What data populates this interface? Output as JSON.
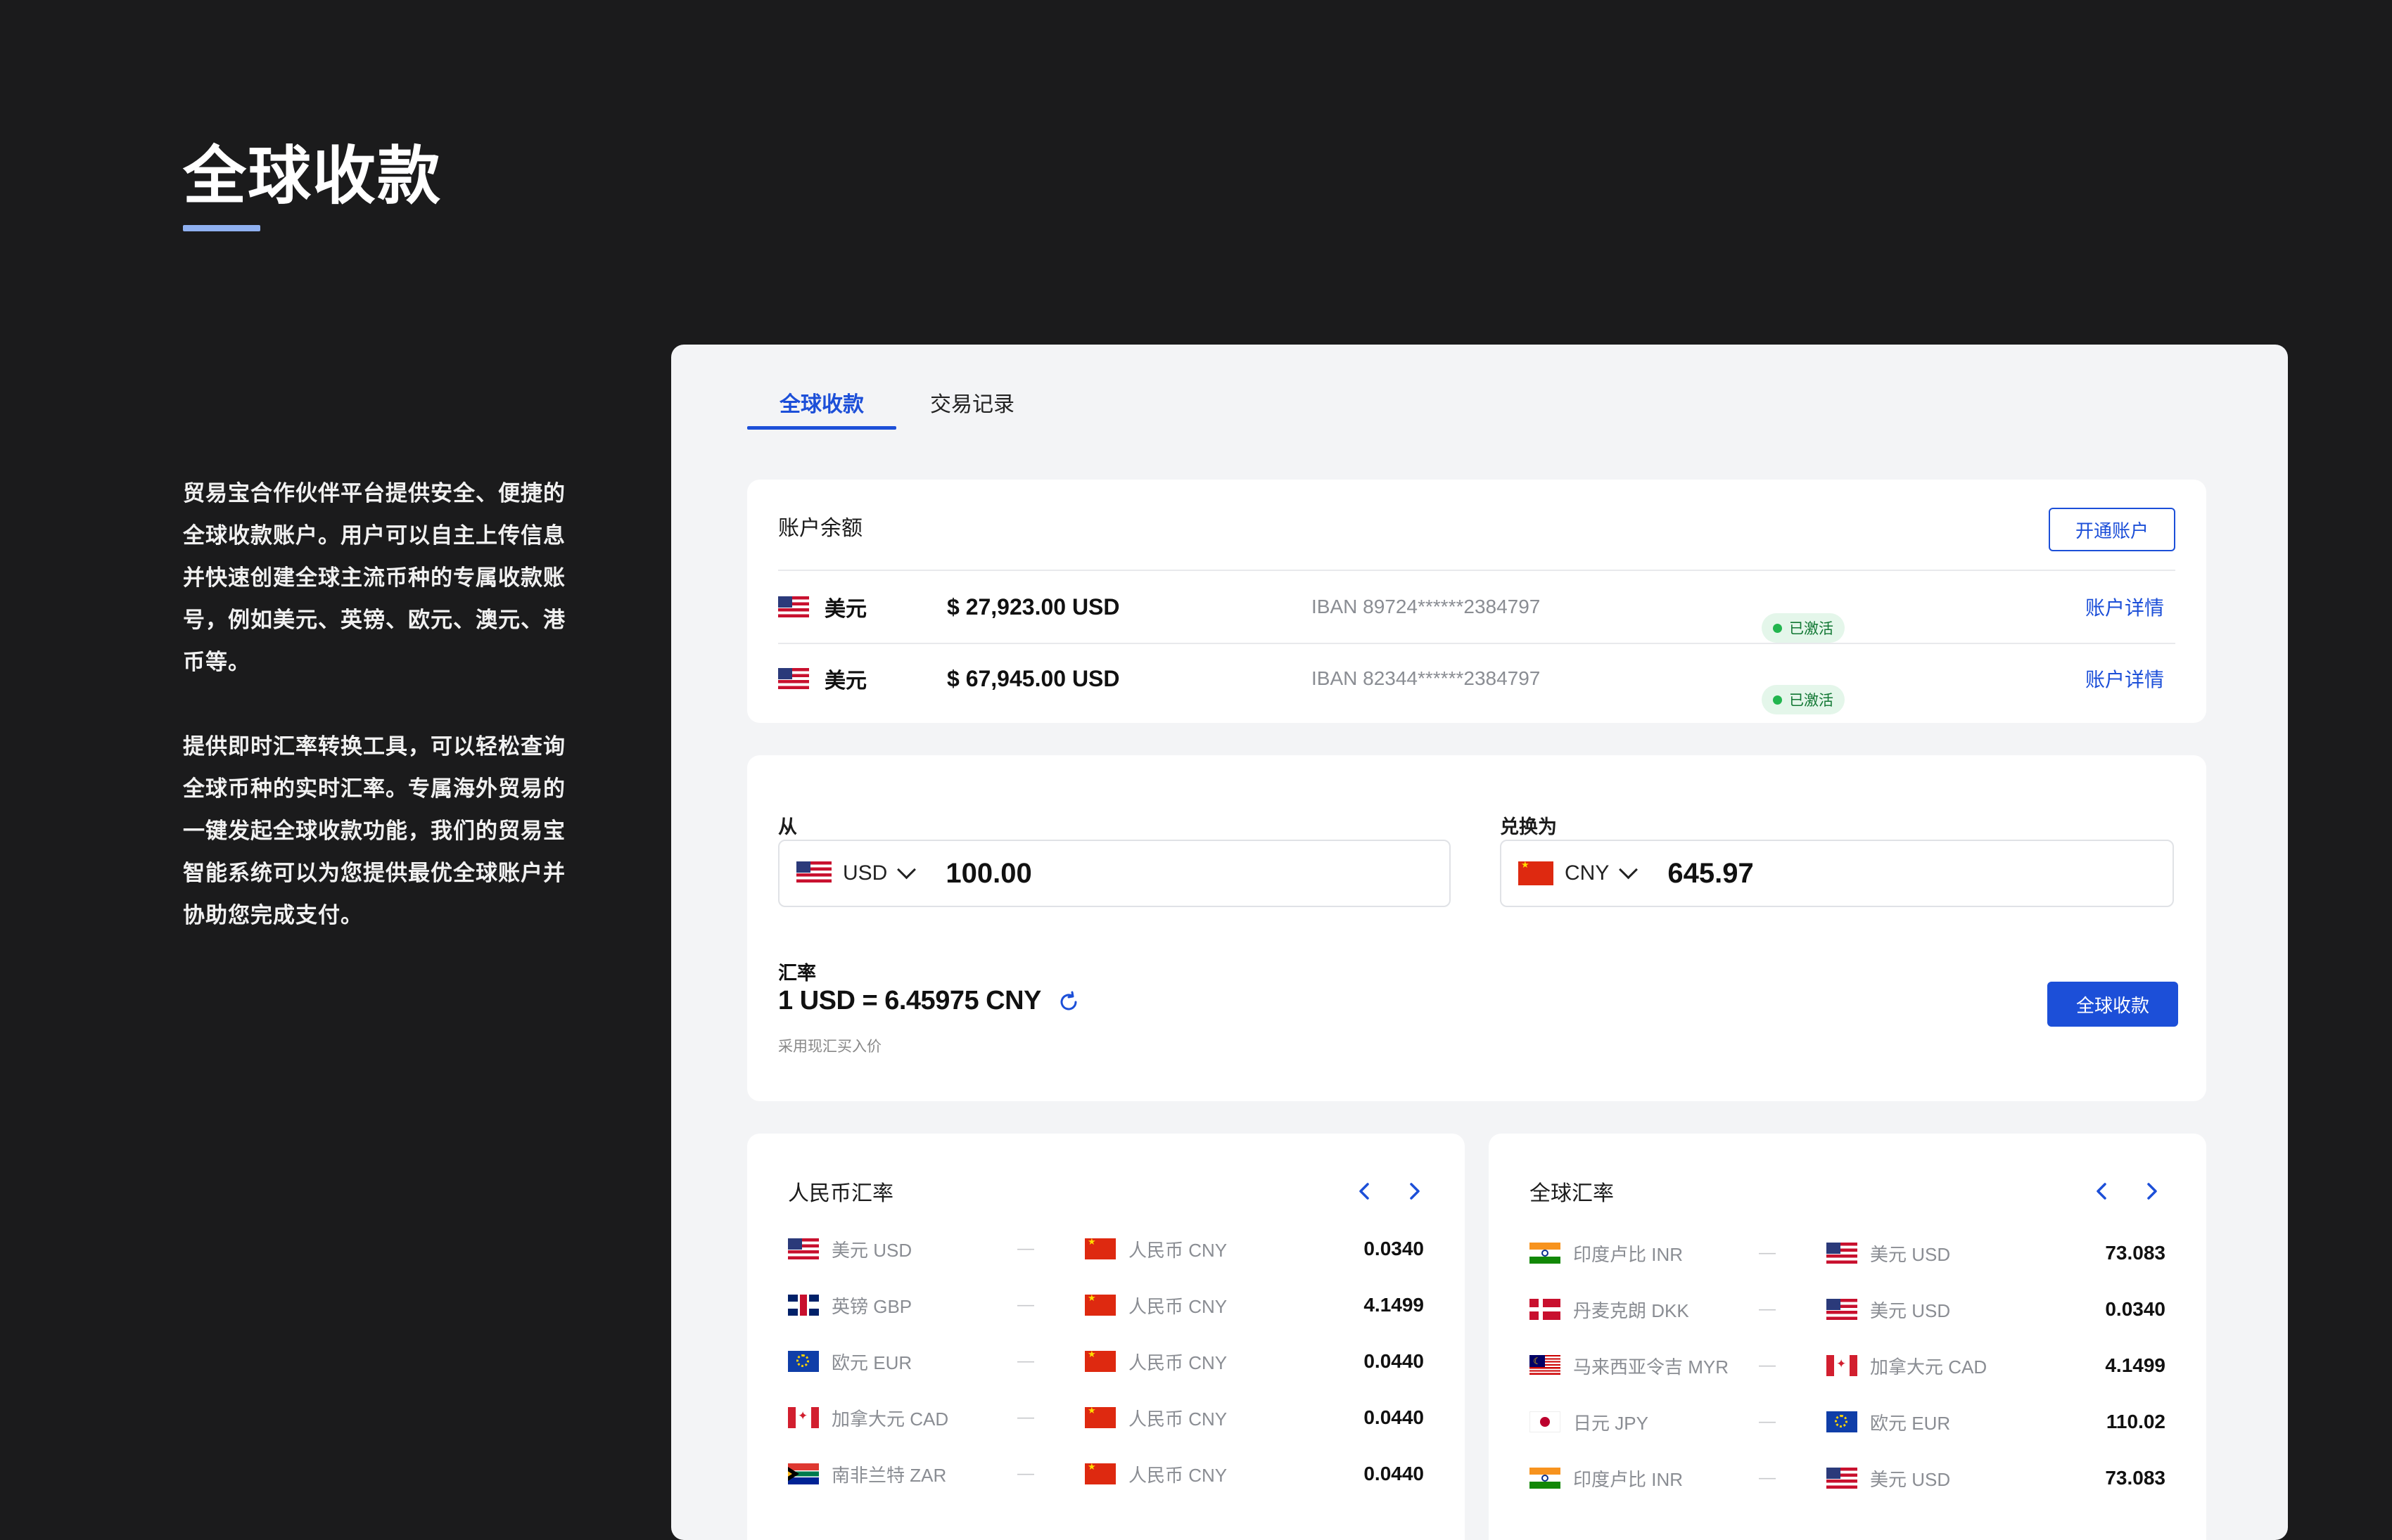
{
  "hero": {
    "title": "全球收款",
    "paragraphs": [
      "贸易宝合作伙伴平台提供安全、便捷的全球收款账户。用户可以自主上传信息并快速创建全球主流币种的专属收款账号，例如美元、英镑、欧元、澳元、港币等。",
      "提供即时汇率转换工具，可以轻松查询全球币种的实时汇率。专属海外贸易的一键发起全球收款功能，我们的贸易宝智能系统可以为您提供最优全球账户并协助您完成支付。"
    ]
  },
  "tabs": [
    "全球收款",
    "交易记录"
  ],
  "balance": {
    "title": "账户余额",
    "open_button": "开通账户",
    "rows": [
      {
        "flag": "us",
        "currency": "美元",
        "amount": "$ 27,923.00 USD",
        "iban": "IBAN 89724******2384797",
        "status": "已激活",
        "link": "账户详情"
      },
      {
        "flag": "us",
        "currency": "美元",
        "amount": "$ 67,945.00 USD",
        "iban": "IBAN 82344******2384797",
        "status": "已激活",
        "link": "账户详情"
      }
    ]
  },
  "converter": {
    "from_label": "从",
    "to_label": "兑换为",
    "from": {
      "flag": "us",
      "currency": "USD",
      "amount": "100.00"
    },
    "to": {
      "flag": "cn",
      "currency": "CNY",
      "amount": "645.97"
    },
    "rate_label": "汇率",
    "rate": "1 USD = 6.45975 CNY",
    "rate_note": "采用现汇买入价",
    "action_button": "全球收款"
  },
  "cny_rates": {
    "title": "人民币汇率",
    "rows": [
      {
        "from_flag": "us",
        "from": "美元 USD",
        "to_flag": "cn",
        "to": "人民币 CNY",
        "rate": "0.0340"
      },
      {
        "from_flag": "gb",
        "from": "英镑 GBP",
        "to_flag": "cn",
        "to": "人民币 CNY",
        "rate": "4.1499"
      },
      {
        "from_flag": "eu",
        "from": "欧元 EUR",
        "to_flag": "cn",
        "to": "人民币 CNY",
        "rate": "0.0440"
      },
      {
        "from_flag": "ca",
        "from": "加拿大元 CAD",
        "to_flag": "cn",
        "to": "人民币 CNY",
        "rate": "0.0440"
      },
      {
        "from_flag": "za",
        "from": "南非兰特 ZAR",
        "to_flag": "cn",
        "to": "人民币 CNY",
        "rate": "0.0440"
      }
    ]
  },
  "global_rates": {
    "title": "全球汇率",
    "rows": [
      {
        "from_flag": "in",
        "from": "印度卢比 INR",
        "to_flag": "us",
        "to": "美元 USD",
        "rate": "73.083"
      },
      {
        "from_flag": "dk",
        "from": "丹麦克朗 DKK",
        "to_flag": "us",
        "to": "美元 USD",
        "rate": "0.0340"
      },
      {
        "from_flag": "my",
        "from": "马来西亚令吉 MYR",
        "to_flag": "ca",
        "to": "加拿大元 CAD",
        "rate": "4.1499"
      },
      {
        "from_flag": "jp",
        "from": "日元 JPY",
        "to_flag": "eu",
        "to": "欧元 EUR",
        "rate": "110.02"
      },
      {
        "from_flag": "in",
        "from": "印度卢比 INR",
        "to_flag": "us",
        "to": "美元 USD",
        "rate": "73.083"
      }
    ]
  },
  "colors": {
    "accent": "#1c4fd8",
    "background": "#1b1b1c",
    "panel": "#f3f4f6",
    "active_green": "#22b54e"
  }
}
